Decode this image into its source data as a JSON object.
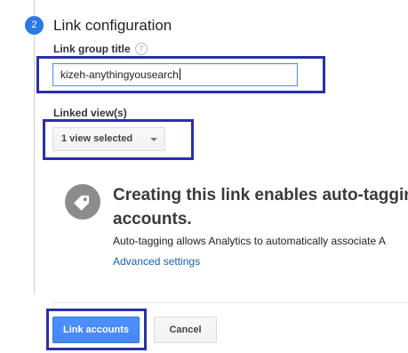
{
  "step": {
    "number": "2",
    "title": "Link configuration"
  },
  "link_group": {
    "label": "Link group title",
    "help_icon": "question-mark-icon",
    "value": "kizeh-anythingyousearch"
  },
  "linked_views": {
    "label": "Linked view(s)",
    "selected": "1 view selected"
  },
  "info": {
    "icon": "tag-icon",
    "heading_line1": "Creating this link enables auto-taggin",
    "heading_line2": "accounts.",
    "description": "Auto-tagging allows Analytics to automatically associate A",
    "advanced_link": "Advanced settings"
  },
  "actions": {
    "link_accounts": "Link accounts",
    "cancel": "Cancel"
  },
  "colors": {
    "accent": "#4d90fe",
    "highlight": "#2a2fa8",
    "step_badge": "#2a7ae2",
    "link": "#1a5fb4"
  }
}
